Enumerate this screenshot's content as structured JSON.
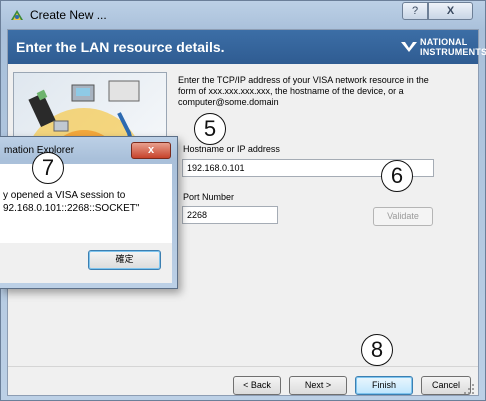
{
  "window": {
    "title": "Create New ...",
    "help_label": "?",
    "close_label": "X"
  },
  "header": {
    "title": "Enter the LAN resource details.",
    "logo_line1": "NATIONAL",
    "logo_line2": "INSTRUMENTS"
  },
  "form": {
    "instructions": "Enter the TCP/IP address of your VISA network resource in the form of xxx.xxx.xxx.xxx, the hostname of the device, or a computer@some.domain",
    "hostname_label": "Hostname or IP address",
    "hostname_value": "192.168.0.101",
    "port_label": "Port Number",
    "port_value": "2268",
    "validate_label": "Validate"
  },
  "footer": {
    "back_label": "< Back",
    "next_label": "Next >",
    "finish_label": "Finish",
    "cancel_label": "Cancel"
  },
  "dialog": {
    "title": "mation Explorer",
    "message_line1": "y opened a VISA session to",
    "message_line2": "92.168.0.101::2268::SOCKET\"",
    "ok_label": "確定",
    "close_label": "x"
  },
  "callouts": [
    "5",
    "6",
    "7",
    "8"
  ]
}
